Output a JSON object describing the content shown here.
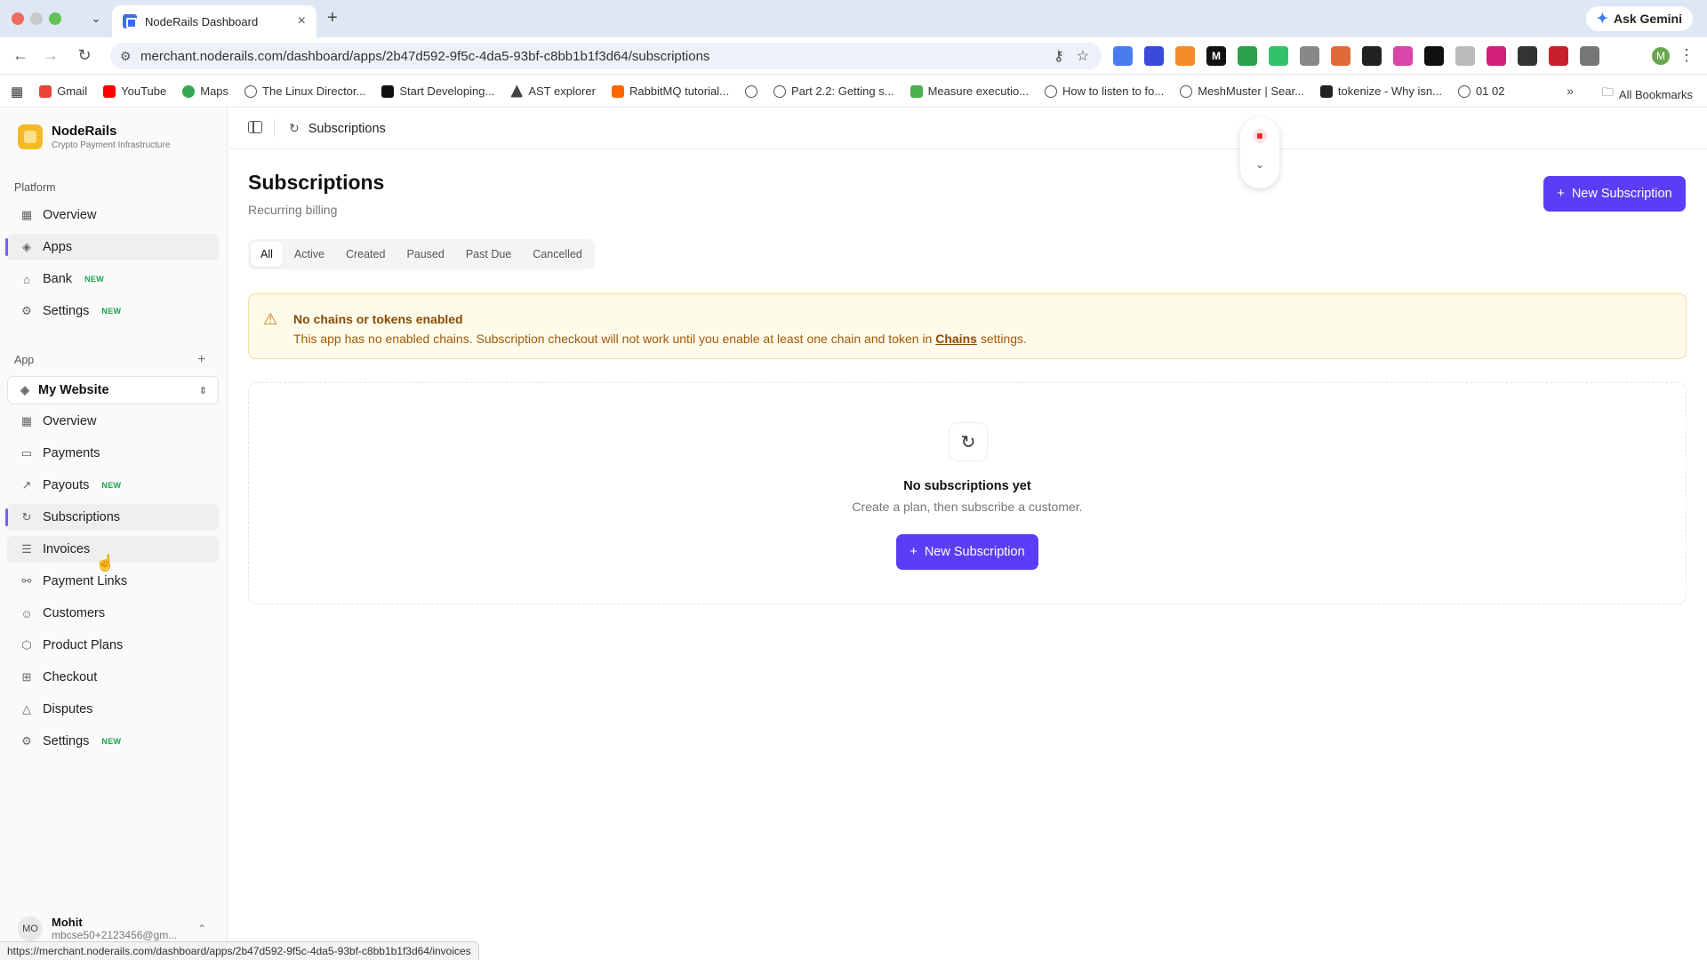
{
  "browser": {
    "tab_title": "NodeRails Dashboard",
    "tab_close": "×",
    "new_tab": "+",
    "ask_gemini": "Ask Gemini",
    "url": "merchant.noderails.com/dashboard/apps/2b47d592-9f5c-4da5-93bf-c8bb1b1f3d64/subscriptions",
    "profile_initial": "M",
    "bookmarks": [
      "Gmail",
      "YouTube",
      "Maps",
      "The Linux Director...",
      "Start Developing...",
      "AST explorer",
      "RabbitMQ tutorial...",
      "Part 2.2: Getting s...",
      "Measure executio...",
      "How to listen to fo...",
      "MeshMuster | Sear...",
      "tokenize - Why isn...",
      "01 02"
    ],
    "bookmarks_more": "»",
    "all_bookmarks": "All Bookmarks",
    "status_url": "https://merchant.noderails.com/dashboard/apps/2b47d592-9f5c-4da5-93bf-c8bb1b1f3d64/invoices"
  },
  "sidebar": {
    "brand_name": "NodeRails",
    "brand_tagline": "Crypto Payment Infrastructure",
    "platform_label": "Platform",
    "platform_items": [
      {
        "label": "Overview",
        "icon": "grid-icon"
      },
      {
        "label": "Apps",
        "icon": "layers-icon"
      },
      {
        "label": "Bank",
        "icon": "bank-icon",
        "badge": "NEW"
      },
      {
        "label": "Settings",
        "icon": "gear-icon",
        "badge": "NEW"
      }
    ],
    "app_label": "App",
    "app_selected": "My Website",
    "app_items": [
      {
        "label": "Overview",
        "icon": "grid-icon"
      },
      {
        "label": "Payments",
        "icon": "card-icon"
      },
      {
        "label": "Payouts",
        "icon": "arrow-up-right-icon",
        "badge": "NEW"
      },
      {
        "label": "Subscriptions",
        "icon": "refresh-icon"
      },
      {
        "label": "Invoices",
        "icon": "receipt-icon"
      },
      {
        "label": "Payment Links",
        "icon": "link-icon"
      },
      {
        "label": "Customers",
        "icon": "users-icon"
      },
      {
        "label": "Product Plans",
        "icon": "box-icon"
      },
      {
        "label": "Checkout",
        "icon": "cart-icon"
      },
      {
        "label": "Disputes",
        "icon": "warning-icon"
      },
      {
        "label": "Settings",
        "icon": "gear-icon",
        "badge": "NEW"
      }
    ],
    "user_initials": "MO",
    "user_name": "Mohit",
    "user_email": "mbcse50+2123456@gm..."
  },
  "main": {
    "breadcrumb": "Subscriptions",
    "title": "Subscriptions",
    "subtitle": "Recurring billing",
    "new_button": "New Subscription",
    "tabs": [
      "All",
      "Active",
      "Created",
      "Paused",
      "Past Due",
      "Cancelled"
    ],
    "active_tab": "All",
    "alert": {
      "heading": "No chains or tokens enabled",
      "body_before": "This app has no enabled chains. Subscription checkout will not work until you enable at least one chain and token in",
      "link": "Chains",
      "body_after": "settings."
    },
    "empty": {
      "heading": "No subscriptions yet",
      "subtext": "Create a plan, then subscribe a customer.",
      "button": "New Subscription"
    }
  },
  "colors": {
    "accent": "#5b3df5",
    "alert_bg": "#fffbea",
    "new_badge": "#1aa34a"
  }
}
